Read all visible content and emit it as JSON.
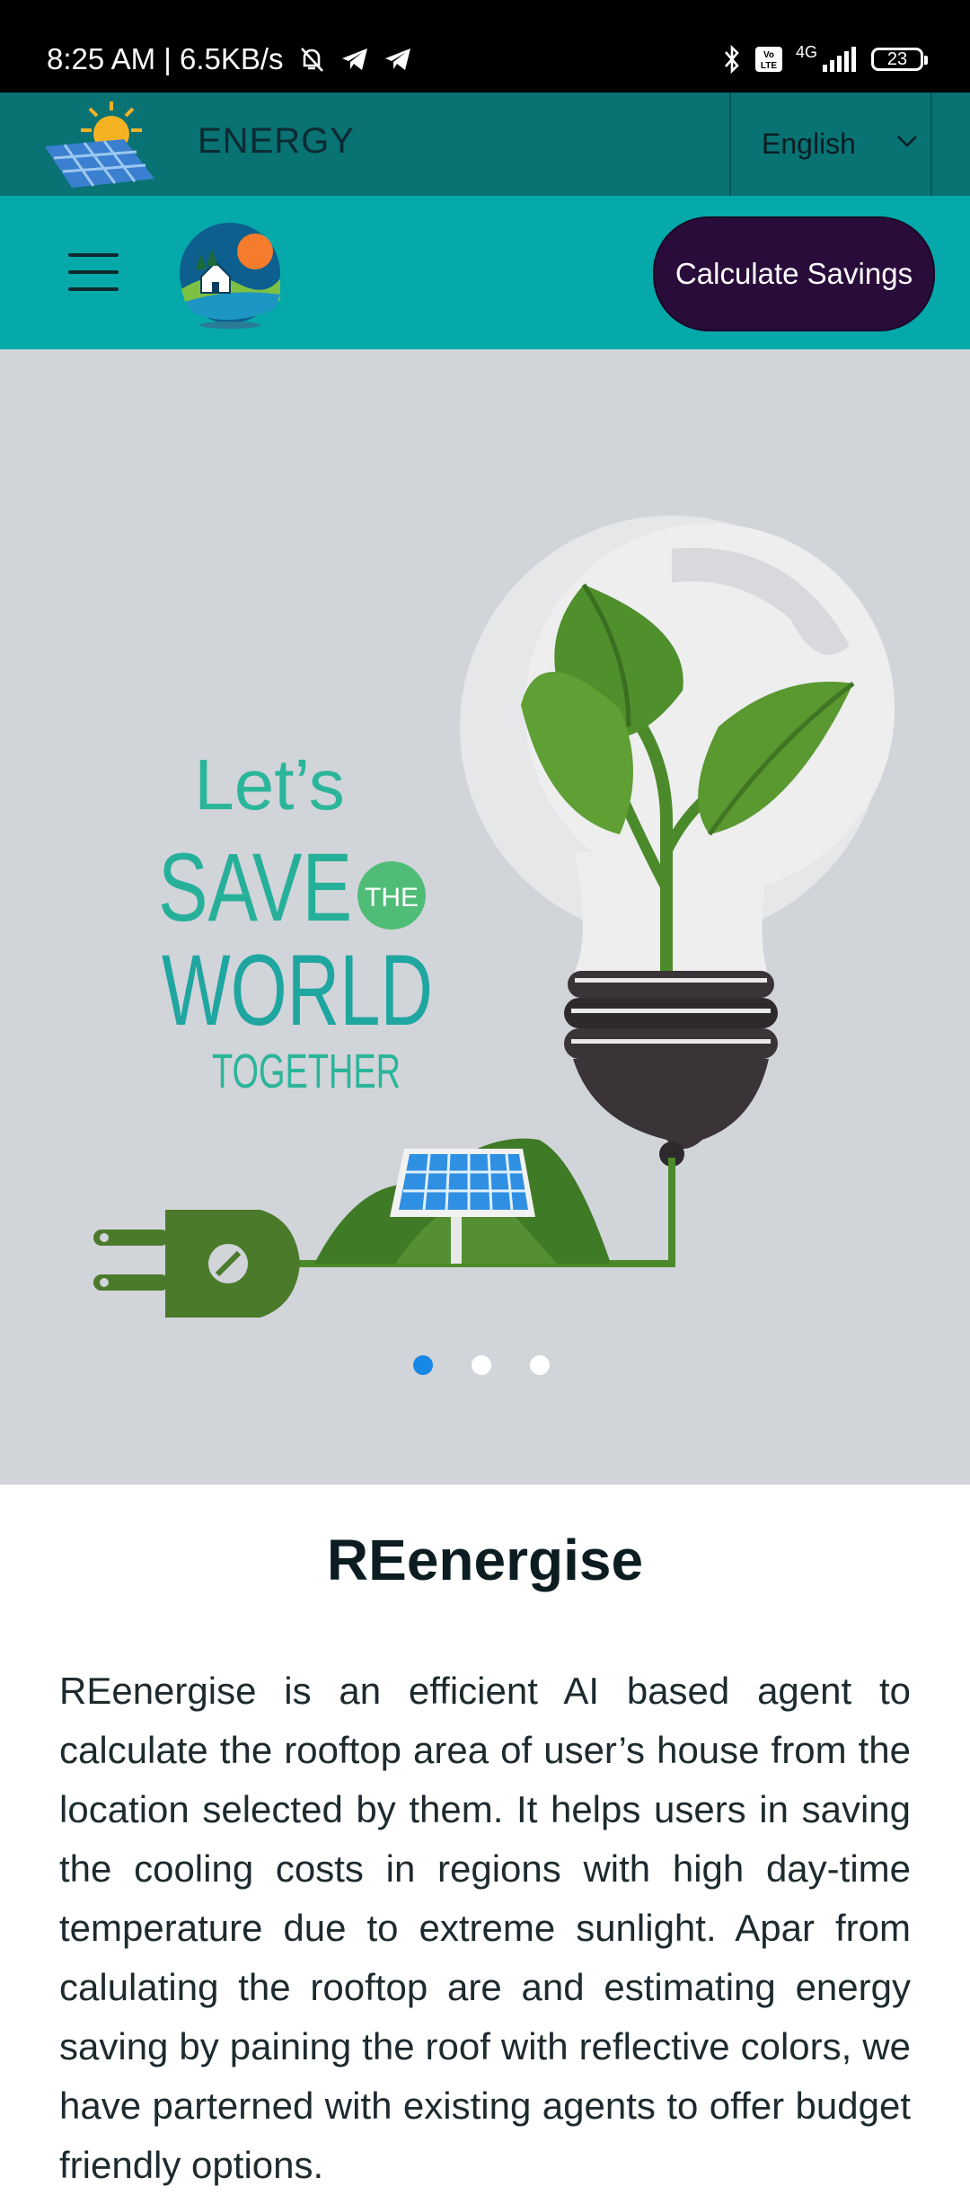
{
  "status_bar": {
    "time_info": "8:25 AM | 6.5KB/s",
    "icons": [
      "mute-bell-icon",
      "telegram-icon",
      "telegram-icon",
      "bluetooth-icon",
      "volte-icon",
      "signal-icon"
    ],
    "network": "4G",
    "battery": "23"
  },
  "header": {
    "brand": "ENERGY",
    "language": "English"
  },
  "nav": {
    "cta_label": "Calculate Savings"
  },
  "hero": {
    "slogan": {
      "line1": "Let’s",
      "line2": "SAVE",
      "badge": "THE",
      "line3": "WORLD",
      "line4": "TOGETHER"
    },
    "slides": 3,
    "active_slide": 1,
    "colors": {
      "teal_text": "#2bb59a",
      "leaf": "#4e8a2f",
      "bulb": "#efefef",
      "panel": "#2e8fe0"
    }
  },
  "content": {
    "title": "REenergise",
    "body": "REenergise is an efficient AI based agent to calculate the rooftop area of user’s house from the location selected by them. It helps users in saving the cooling costs in regions with high day-time temperature due to extreme sunlight. Apar from calulating the rooftop are and estimating energy saving by paining the roof with reflective colors, we have parterned with existing agents to offer budget friendly options."
  },
  "colors": {
    "status_bar": "#000000",
    "header": "#097273",
    "nav": "#05a9aa",
    "cta": "#2a0c3b",
    "hero_bg": "#d1d4d9",
    "dot_active": "#1888e6"
  }
}
